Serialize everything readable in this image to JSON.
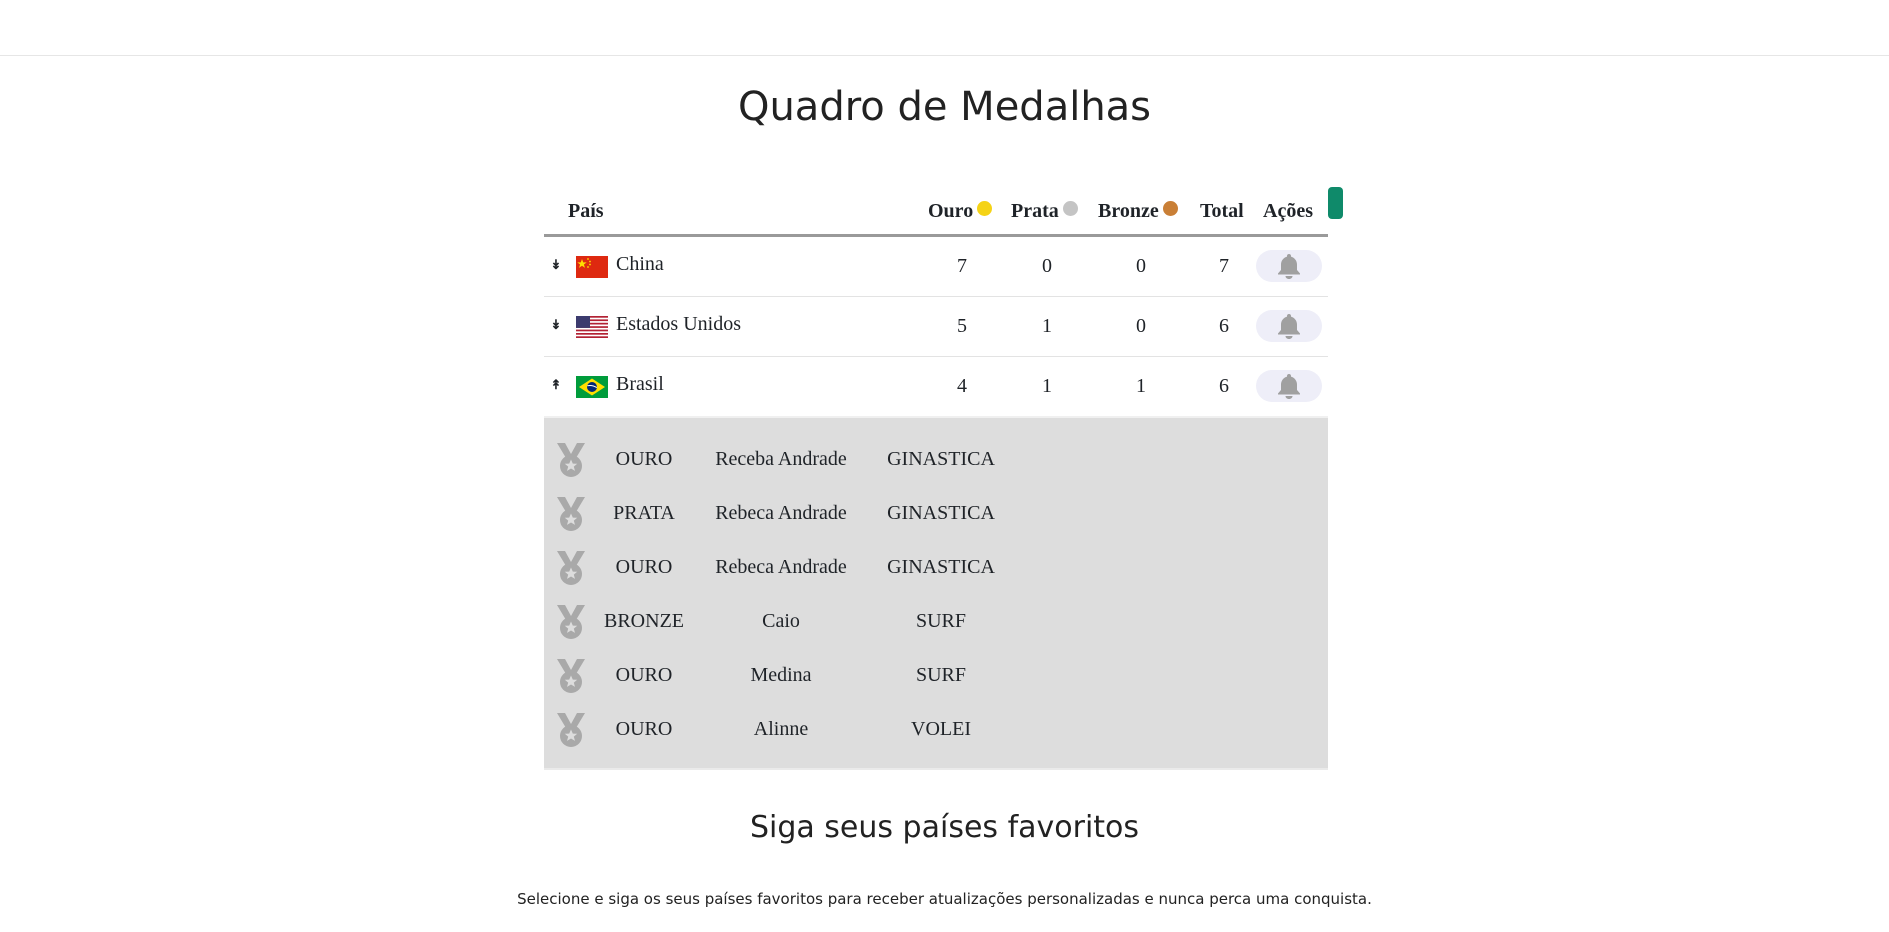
{
  "page": {
    "title": "Quadro de Medalhas",
    "follow_title": "Siga seus países favoritos",
    "follow_text": "Selecione e siga os seus países favoritos para receber atualizações personalizadas e nunca perca uma conquista."
  },
  "table": {
    "headers": {
      "country": "País",
      "gold": "Ouro",
      "silver": "Prata",
      "bronze": "Bronze",
      "total": "Total",
      "actions": "Ações"
    },
    "rows": [
      {
        "toggle": "↡",
        "flag": "china-flag-icon",
        "country": "China",
        "gold": "7",
        "silver": "0",
        "bronze": "0",
        "total": "7"
      },
      {
        "toggle": "↡",
        "flag": "usa-flag-icon",
        "country": "Estados Unidos",
        "gold": "5",
        "silver": "1",
        "bronze": "0",
        "total": "6"
      },
      {
        "toggle": "↟",
        "flag": "brazil-flag-icon",
        "country": "Brasil",
        "gold": "4",
        "silver": "1",
        "bronze": "1",
        "total": "6"
      }
    ],
    "expanded_medals": [
      {
        "type": "OURO",
        "athlete": "Receba Andrade",
        "sport": "GINASTICA"
      },
      {
        "type": "PRATA",
        "athlete": "Rebeca Andrade",
        "sport": "GINASTICA"
      },
      {
        "type": "OURO",
        "athlete": "Rebeca Andrade",
        "sport": "GINASTICA"
      },
      {
        "type": "BRONZE",
        "athlete": "Caio",
        "sport": "SURF"
      },
      {
        "type": "OURO",
        "athlete": "Medina",
        "sport": "SURF"
      },
      {
        "type": "OURO",
        "athlete": "Alinne",
        "sport": "VOLEI"
      }
    ]
  },
  "colors": {
    "gold": "#f5d316",
    "silver": "#c4c4c4",
    "bronze": "#c97f36",
    "accent": "#0f8a6a",
    "bell": "#a0a0a0",
    "detail_bg": "#dddddd"
  },
  "icons": {
    "notify": "bell-icon",
    "medal": "medal-icon"
  }
}
